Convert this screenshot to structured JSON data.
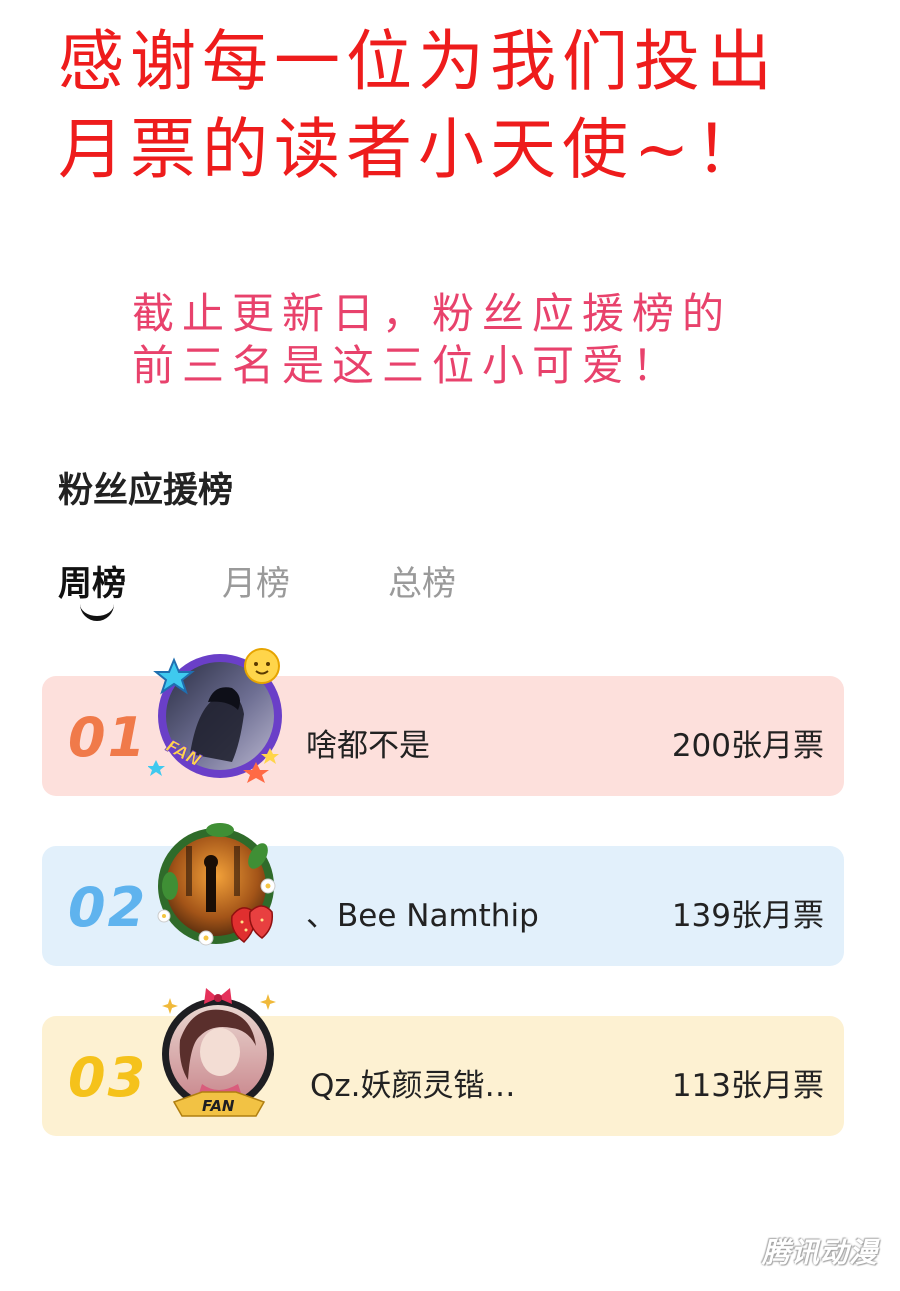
{
  "headline": {
    "line1": "感谢每一位为我们投出",
    "line2": "月票的读者小天使~！"
  },
  "subline": {
    "line1": "截止更新日，粉丝应援榜的",
    "line2": "前三名是这三位小可爱！"
  },
  "board": {
    "title": "粉丝应援榜",
    "tabs": [
      {
        "label": "周榜",
        "active": true
      },
      {
        "label": "月榜",
        "active": false
      },
      {
        "label": "总榜",
        "active": false
      }
    ],
    "entries": [
      {
        "rank": "01",
        "name": "啥都不是",
        "votes": "200张月票",
        "bg": "#fde0dc",
        "rank_color": "#f07a4a",
        "badge": "FAN"
      },
      {
        "rank": "02",
        "name": "、Bee Namthip",
        "votes": "139张月票",
        "bg": "#e2f0fb",
        "rank_color": "#5fb3ee",
        "badge": ""
      },
      {
        "rank": "03",
        "name": "Qz.妖颜灵锴…",
        "votes": "113张月票",
        "bg": "#fdf1d2",
        "rank_color": "#f5c21b",
        "badge": "FAN"
      }
    ]
  },
  "watermark": "腾讯动漫"
}
